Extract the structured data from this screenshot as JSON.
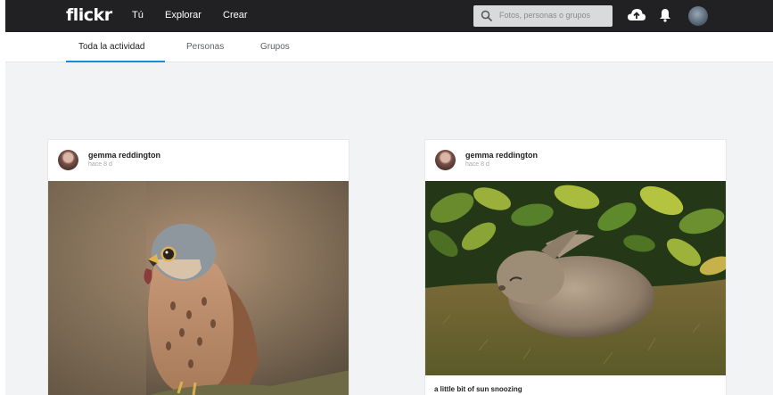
{
  "brand": {
    "logo_text": "flickr"
  },
  "nav": {
    "links": [
      "Tú",
      "Explorar",
      "Crear"
    ],
    "search_placeholder": "Fotos, personas o grupos",
    "icons": [
      "upload-cloud-icon",
      "notifications-bell-icon",
      "user-avatar"
    ]
  },
  "tabs": {
    "items": [
      "Toda la actividad",
      "Personas",
      "Grupos"
    ],
    "active": "Toda la actividad"
  },
  "feed": [
    {
      "user": "gemma reddington",
      "time": "hace 8 d",
      "caption": ""
    },
    {
      "user": "gemma reddington",
      "time": "hace 8 d",
      "caption": "a little bit of sun snoozing"
    }
  ],
  "colors": {
    "topbar": "#212124",
    "accent": "#128fdc",
    "background": "#f2f3f4"
  }
}
